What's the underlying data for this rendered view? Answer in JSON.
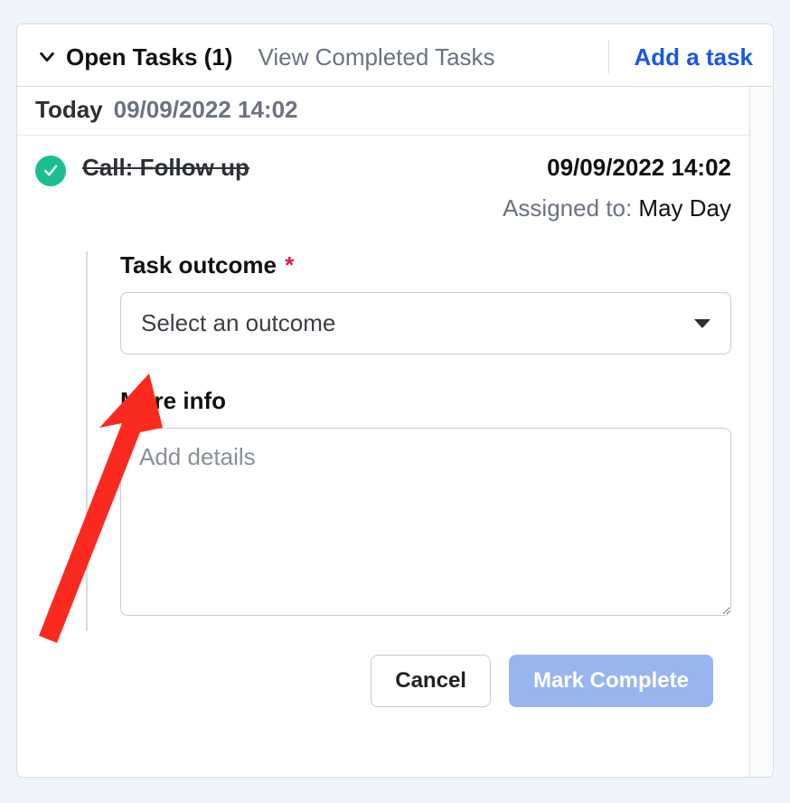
{
  "header": {
    "open_tasks_label": "Open Tasks (1)",
    "view_completed_label": "View Completed Tasks",
    "add_task_label": "Add a task"
  },
  "date_row": {
    "today_label": "Today",
    "timestamp": "09/09/2022 14:02"
  },
  "task": {
    "title": "Call: Follow up",
    "timestamp": "09/09/2022 14:02",
    "assigned_label": "Assigned to:",
    "assigned_value": "May Day"
  },
  "form": {
    "outcome_label": "Task outcome",
    "required_mark": "*",
    "outcome_placeholder": "Select an outcome",
    "more_info_label": "More info",
    "details_placeholder": "Add details"
  },
  "actions": {
    "cancel_label": "Cancel",
    "complete_label": "Mark Complete"
  }
}
